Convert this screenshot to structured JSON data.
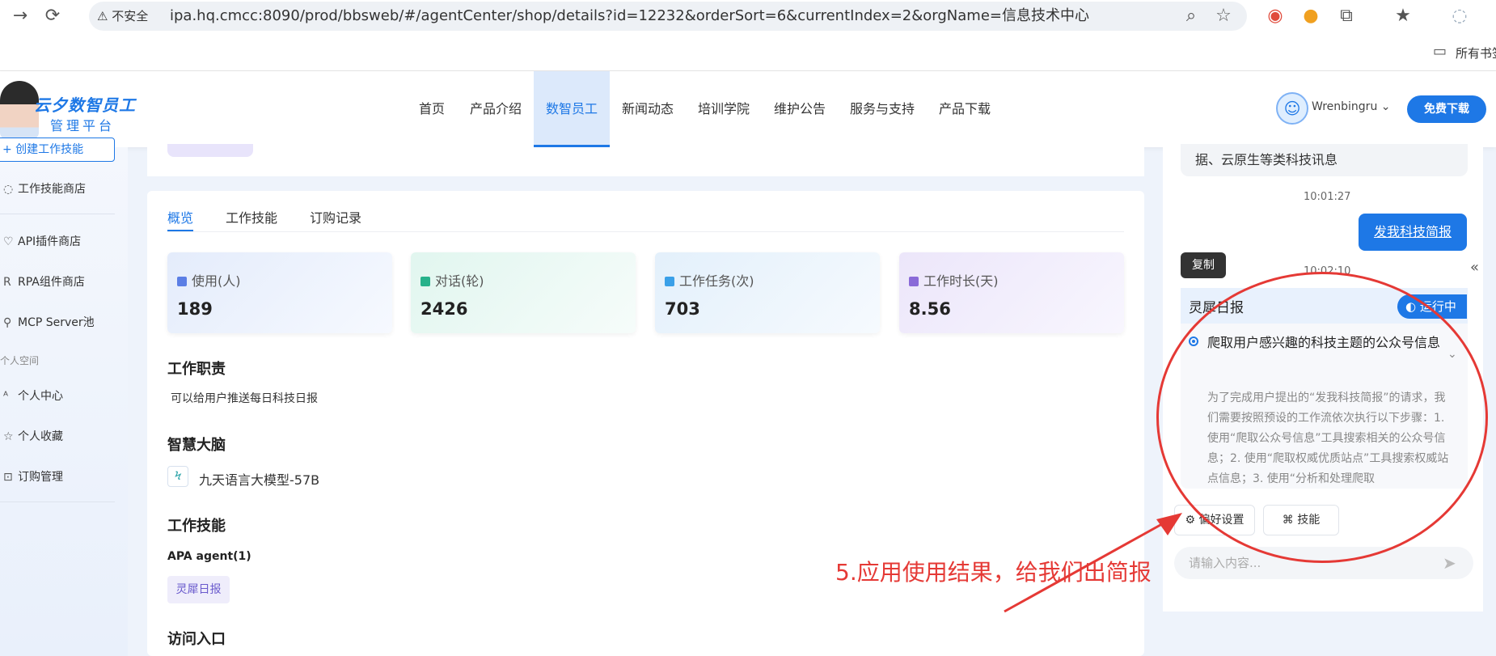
{
  "browser": {
    "insecure_label": "不安全",
    "url": "ipa.hq.cmcc:8090/prod/bbsweb/#/agentCenter/shop/details?id=12232&orderSort=6&currentIndex=2&orgName=信息技术中心",
    "bookmarks_label": "所有书签"
  },
  "header": {
    "logo_title": "云夕数智员工",
    "logo_sub": "管理平台",
    "nav": [
      "首页",
      "产品介绍",
      "数智员工",
      "新闻动态",
      "培训学院",
      "维护公告",
      "服务与支持",
      "产品下载"
    ],
    "active_nav": "数智员工",
    "user_name": "Wrenbingru",
    "download_label": "免费下载"
  },
  "sidebar": {
    "create_label": "+ 创建工作技能",
    "items": [
      "工作技能商店",
      "API插件商店",
      "RPA组件商店",
      "MCP Server池"
    ],
    "section_label": "个人空间",
    "personal_items": [
      "个人中心",
      "个人收藏",
      "订购管理"
    ]
  },
  "main": {
    "tabs": [
      "概览",
      "工作技能",
      "订购记录"
    ],
    "stats": [
      {
        "label": "使用(人)",
        "value": "189",
        "color": "#5b7ee5"
      },
      {
        "label": "对话(轮)",
        "value": "2426",
        "color": "#27b28b"
      },
      {
        "label": "工作任务(次)",
        "value": "703",
        "color": "#3aa0e8"
      },
      {
        "label": "工作时长(天)",
        "value": "8.56",
        "color": "#8a6ad8"
      }
    ],
    "duty_title": "工作职责",
    "duty_text": "可以给用户推送每日科技日报",
    "brain_title": "智慧大脑",
    "brain_model": "九天语言大模型-57B",
    "skill_title": "工作技能",
    "skill_group": "APA agent(1)",
    "skill_tag": "灵犀日报",
    "access_title": "访问入口"
  },
  "chat": {
    "prev_message": "据、云原生等类科技讯息",
    "time1": "10:01:27",
    "user_message": "发我科技简报",
    "copy_tooltip": "复制",
    "time2": "10:02:10",
    "bot_title": "灵犀日报",
    "run_status": "运行中",
    "step_title": "爬取用户感兴趣的科技主题的公众号信息",
    "step_desc": "为了完成用户提出的“发我科技简报”的请求，我们需要按照预设的工作流依次执行以下步骤：1. 使用“爬取公众号信息”工具搜索相关的公众号信息；2. 使用“爬取权威优质站点”工具搜索权威站点信息；3. 使用“分析和处理爬取",
    "pref_button": "偏好设置",
    "skill_button": "技能",
    "input_placeholder": "请输入内容..."
  },
  "annotation": {
    "text": "5.应用使用结果，给我们出简报",
    "color": "#e53935"
  }
}
